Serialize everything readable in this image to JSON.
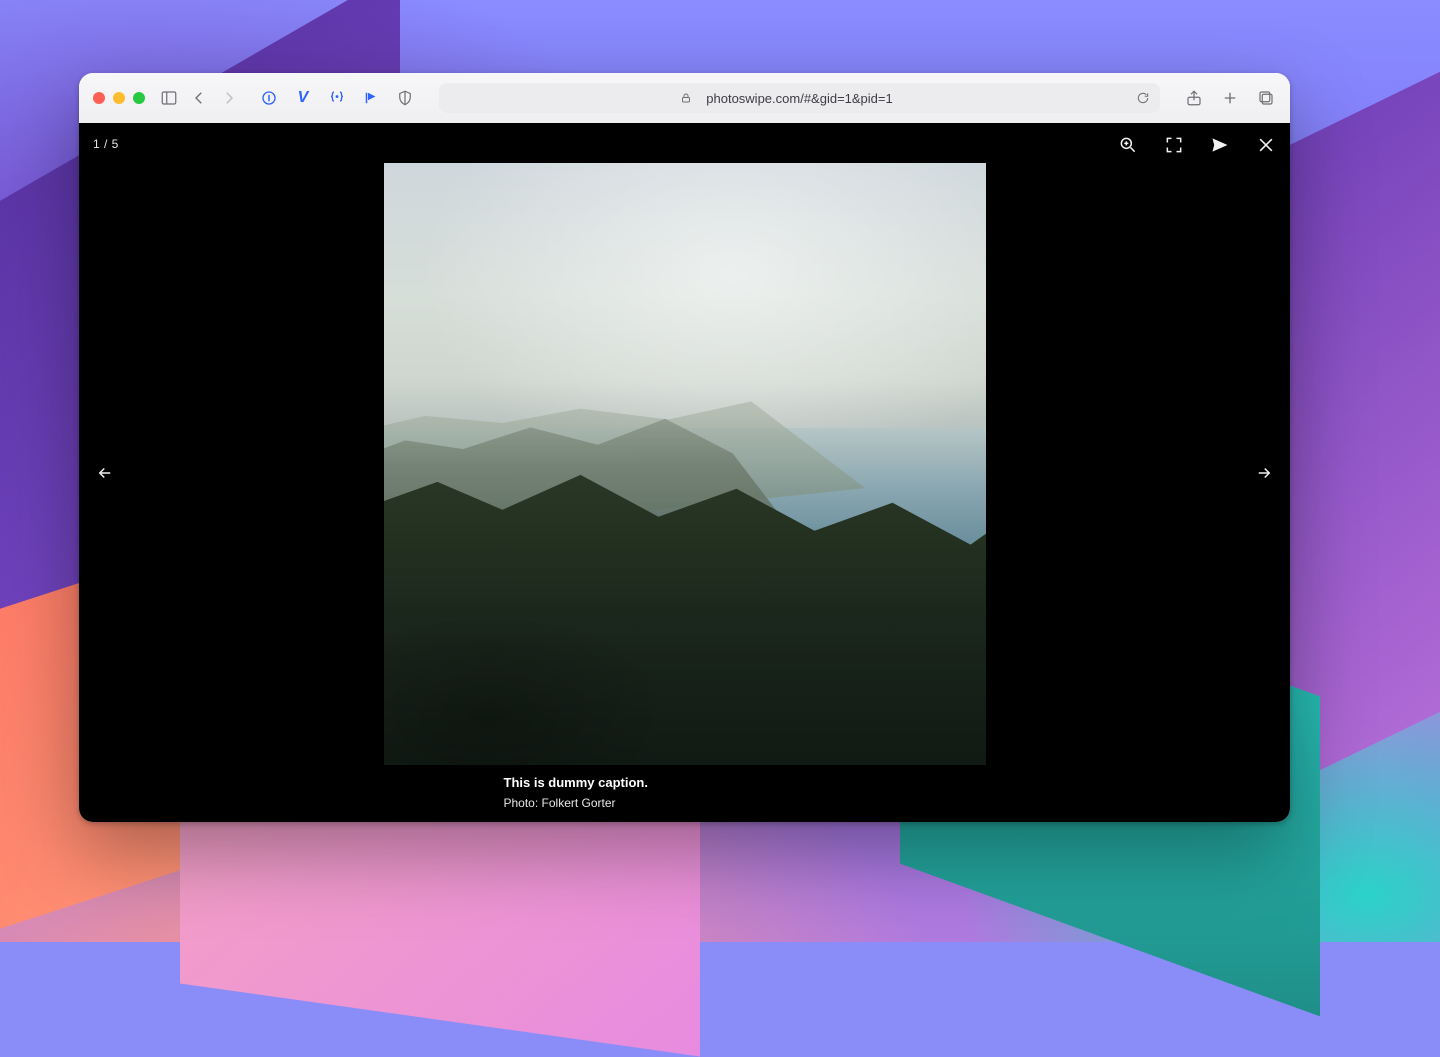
{
  "browser": {
    "url_display": "photoswipe.com/#&gid=1&pid=1"
  },
  "viewer": {
    "counter": "1 / 5",
    "caption_title": "This is dummy caption.",
    "caption_credit": "Photo: Folkert Gorter"
  }
}
